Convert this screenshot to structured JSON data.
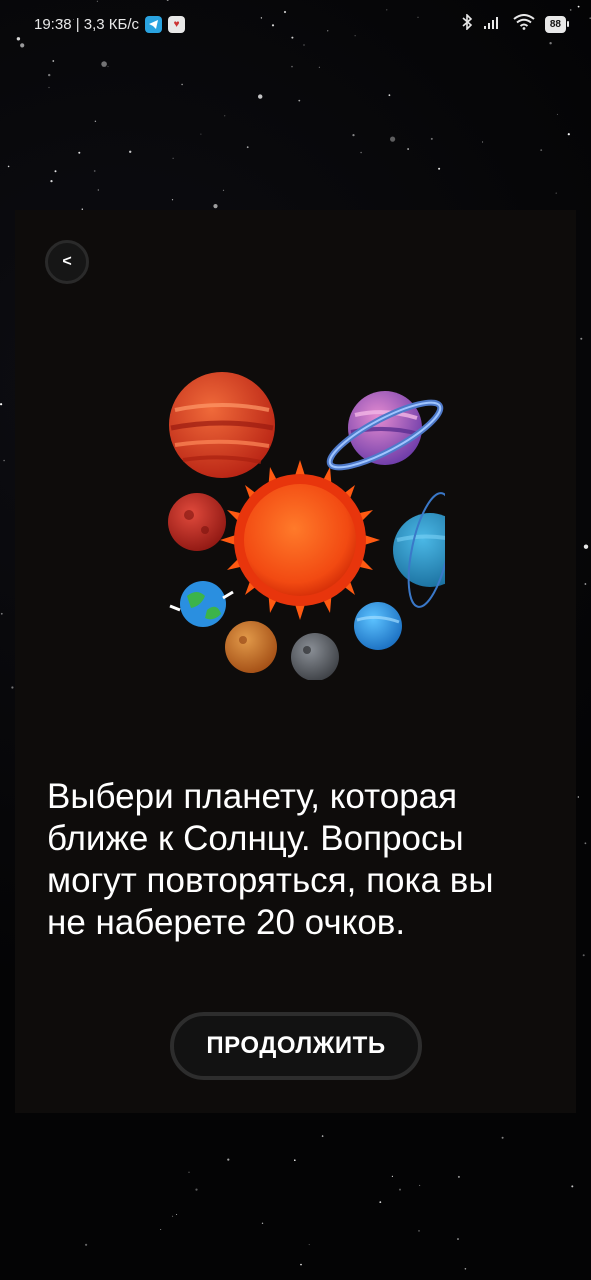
{
  "status_bar": {
    "time_speed": "19:38 | 3,3 КБ/с",
    "telegram_icon": "telegram-icon",
    "app_icon": "notification-app-icon",
    "bluetooth_icon": "bluetooth-icon",
    "signal_icon": "signal-bars-icon",
    "wifi_icon": "wifi-icon",
    "battery_level": "88"
  },
  "card": {
    "back_icon": "back-arrow-icon",
    "back_glyph": "<",
    "question_text": "Выбери планету, которая ближе к Солнцу. Вопросы могут повторяться, пока вы не наберете 20 очков.",
    "continue_label": "ПРОДОЛЖИТЬ",
    "illustration": "solar-system-illustration"
  },
  "colors": {
    "background": "#050507",
    "card_background": "#0e0c0b",
    "button_border": "#2d2d2d",
    "text": "#ffffff"
  }
}
